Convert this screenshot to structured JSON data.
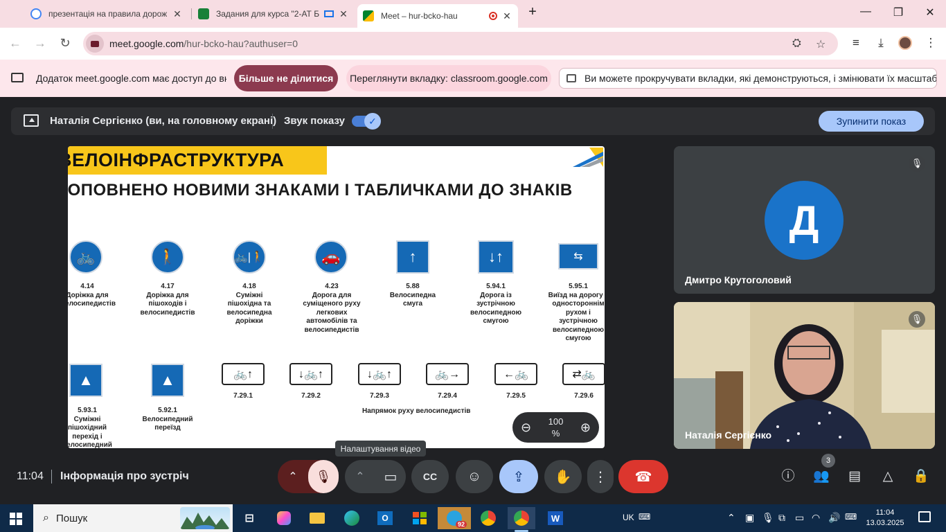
{
  "browser": {
    "tabs": [
      {
        "title": "презентація на правила дорож",
        "favicon_color": "#4285f4"
      },
      {
        "title": "Задания для курса \"2-АТ Б",
        "favicon_color": "#188038"
      },
      {
        "title": "Meet – hur-bcko-hau",
        "favicon_color": "#00897b"
      }
    ],
    "url_host": "meet.google.com",
    "url_path": "/hur-bcko-hau?authuser=0"
  },
  "infobar": {
    "message": "Додаток meet.google.com має доступ до вкладки",
    "stop_sharing_label": "Більше не ділитися",
    "view_tab_label": "Переглянути вкладку: classroom.google.com",
    "hint": "Ви можете прокручувати вкладки, які демонструються, і змінювати їх масштаб"
  },
  "present_bar": {
    "presenter": "Наталія Сергієнко (ви, на головному екрані)",
    "audio_label": "Звук показу",
    "stop_label": "Зупинити показ"
  },
  "slide": {
    "title": "ВЕЛОІНФРАСТРУКТУРА",
    "subtitle": "ДОПОВНЕНО НОВИМИ ЗНАКАМИ І ТАБЛИЧКАМИ ДО ЗНАКІВ",
    "row1": [
      {
        "code": "4.14",
        "caption": "Доріжка для велосипедистів"
      },
      {
        "code": "4.17",
        "caption": "Доріжка для пішоходів і велосипедистів"
      },
      {
        "code": "4.18",
        "caption": "Суміжні пішохідна та велосипедна доріжки"
      },
      {
        "code": "4.23",
        "caption": "Дорога для суміщеного руху легкових автомобілів та велосипедистів"
      },
      {
        "code": "5.88",
        "caption": "Велосипедна смуга"
      },
      {
        "code": "5.94.1",
        "caption": "Дорога із зустрічною велосипедною смугою"
      },
      {
        "code": "5.95.1",
        "caption": "Виїзд на дорогу з одностороннім рухом і зустрічною велосипедною смугою"
      }
    ],
    "row2_signs": [
      {
        "code": "5.93.1",
        "caption": "Суміжні пішохідний перехід і велосипедний переїзд"
      },
      {
        "code": "5.92.1",
        "caption": "Велосипедний переїзд"
      }
    ],
    "plates": [
      "7.29.1",
      "7.29.2",
      "7.29.3",
      "7.29.4",
      "7.29.5",
      "7.29.6"
    ],
    "plates_caption": "Напрямок руху велосипедистів"
  },
  "zoom": {
    "value": "100",
    "unit": "%"
  },
  "participants": [
    {
      "name": "Дмитро Крутоголовий",
      "initial": "Д",
      "avatar_color": "#1a73c9"
    },
    {
      "name": "Наталія Сергієнко"
    }
  ],
  "controls": {
    "time": "11:04",
    "meeting_info": "Інформація про зустріч",
    "tooltip": "Налаштування відео",
    "people_count": "3"
  },
  "taskbar": {
    "search_label": "Пошук",
    "lang": "UK",
    "telegram_badge": "92",
    "time": "11:04",
    "date": "13.03.2025"
  }
}
